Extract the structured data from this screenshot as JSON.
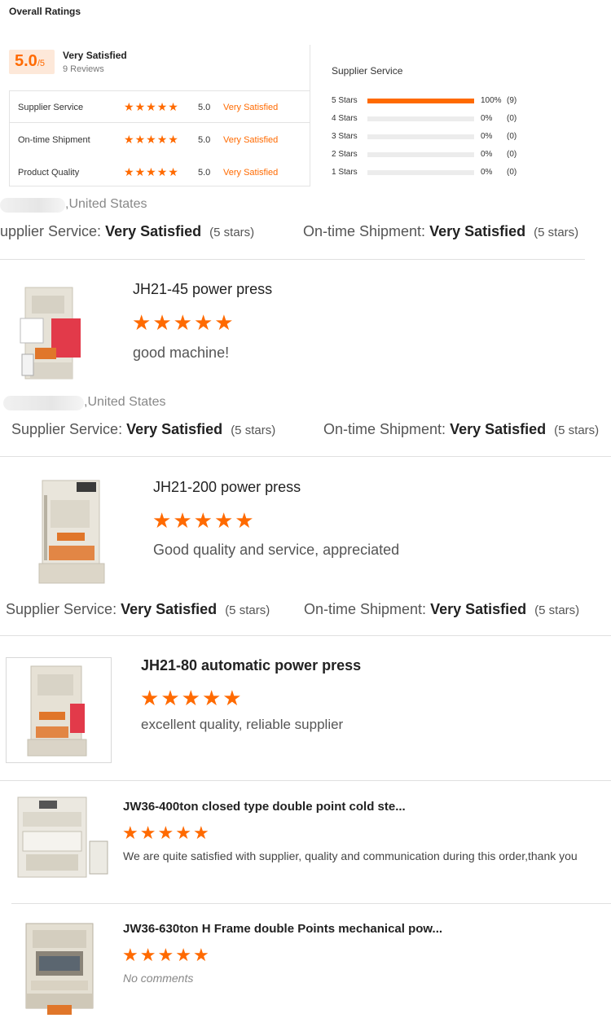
{
  "overview": {
    "title": "Overall Ratings",
    "score": "5.0",
    "score_max": "/5",
    "satisfaction": "Very Satisfied",
    "reviews": "9 Reviews",
    "rows": [
      {
        "label": "Supplier Service",
        "score": "5.0",
        "text": "Very Satisfied",
        "stars": 5
      },
      {
        "label": "On-time Shipment",
        "score": "5.0",
        "text": "Very Satisfied",
        "stars": 5
      },
      {
        "label": "Product Quality",
        "score": "5.0",
        "text": "Very Satisfied",
        "stars": 5
      }
    ]
  },
  "supplier_service": {
    "title": "Supplier Service",
    "bars": [
      {
        "label": "5 Stars",
        "fill": 1.0,
        "pct": "100%",
        "count": "(9)"
      },
      {
        "label": "4 Stars",
        "fill": 0,
        "pct": "0%",
        "count": "(0)"
      },
      {
        "label": "3 Stars",
        "fill": 0,
        "pct": "0%",
        "count": "(0)"
      },
      {
        "label": "2 Stars",
        "fill": 0,
        "pct": "0%",
        "count": "(0)"
      },
      {
        "label": "1 Stars",
        "fill": 0,
        "pct": "0%",
        "count": "(0)"
      }
    ]
  },
  "reviews": [
    {
      "country": ",United States",
      "service_label": "upplier Service:",
      "service_value": "Very Satisfied",
      "service_stars": "(5 stars)",
      "shipment_label": "On-time Shipment:",
      "shipment_value": "Very Satisfied",
      "shipment_stars": "(5 stars)"
    },
    {
      "product": "JH21-45 power press",
      "rating": 5,
      "comment": "good machine!",
      "country": ",United States",
      "service_label": "Supplier Service:",
      "service_value": "Very Satisfied",
      "service_stars": "(5 stars)",
      "shipment_label": "On-time Shipment:",
      "shipment_value": "Very Satisfied",
      "shipment_stars": "(5 stars)"
    },
    {
      "product": "JH21-200 power press",
      "rating": 5,
      "comment": "Good quality and service, appreciated",
      "service_label": "Supplier Service:",
      "service_value": "Very Satisfied",
      "service_stars": "(5 stars)",
      "shipment_label": "On-time Shipment:",
      "shipment_value": "Very Satisfied",
      "shipment_stars": "(5 stars)"
    },
    {
      "product": "JH21-80 automatic power press",
      "rating": 5,
      "comment": "excellent quality, reliable supplier"
    },
    {
      "product": "JW36-400ton closed type double point cold ste...",
      "rating": 5,
      "comment": "We are quite satisfied with supplier, quality and communication during this order,thank you"
    },
    {
      "product": "JW36-630ton H Frame double Points mechanical pow...",
      "rating": 5,
      "comment": "No comments"
    }
  ],
  "colors": {
    "accent": "#ff6a00",
    "accent_bg": "#fde8d9",
    "machine": "#e9e4d8"
  },
  "icons": {
    "star": "star-icon"
  }
}
